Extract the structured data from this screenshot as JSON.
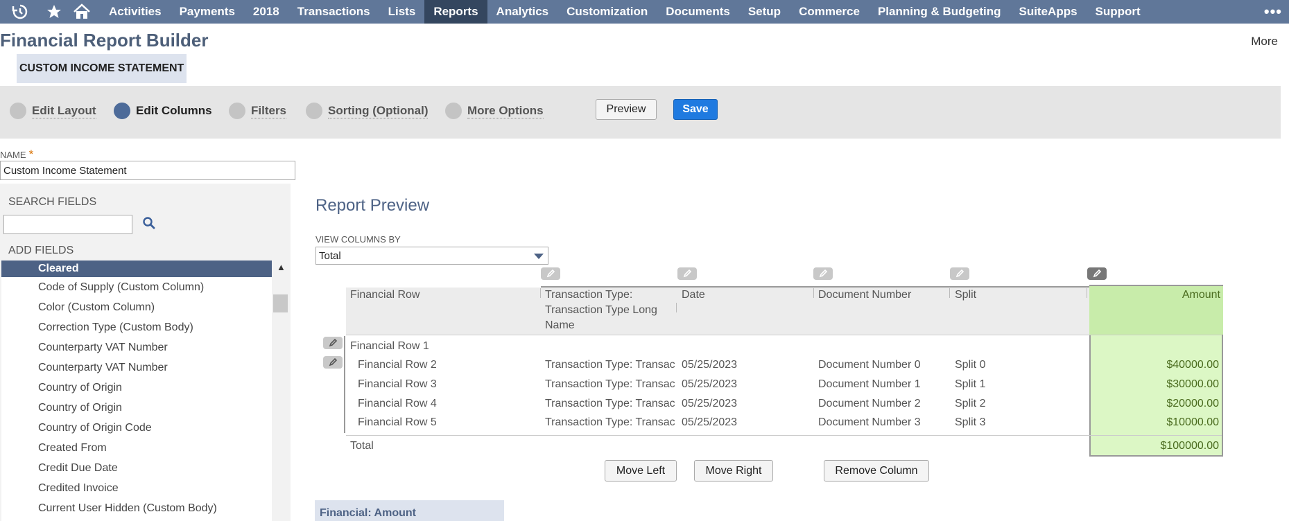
{
  "nav": {
    "items": [
      "Activities",
      "Payments",
      "2018",
      "Transactions",
      "Lists",
      "Reports",
      "Analytics",
      "Customization",
      "Documents",
      "Setup",
      "Commerce",
      "Planning & Budgeting",
      "SuiteApps",
      "Support"
    ],
    "active": "Reports",
    "more_glyph": "•••"
  },
  "header": {
    "title": "Financial Report Builder",
    "more": "More",
    "report_tag": "CUSTOM INCOME STATEMENT"
  },
  "steps": [
    {
      "label": "Edit Layout",
      "current": false
    },
    {
      "label": "Edit Columns",
      "current": true
    },
    {
      "label": "Filters",
      "current": false
    },
    {
      "label": "Sorting (Optional)",
      "current": false
    },
    {
      "label": "More Options",
      "current": false
    }
  ],
  "actions": {
    "preview": "Preview",
    "save": "Save"
  },
  "name_field": {
    "label": "NAME",
    "required": "*",
    "value": "Custom Income Statement"
  },
  "left_panel": {
    "search_title": "SEARCH FIELDS",
    "search_value": "",
    "add_title": "ADD FIELDS",
    "fields": [
      "Cleared",
      "Code of Supply (Custom Column)",
      "Color (Custom Column)",
      "Correction Type (Custom Body)",
      "Counterparty VAT Number",
      "Counterparty VAT Number",
      "Country of Origin",
      "Country of Origin",
      "Country of Origin Code",
      "Created From",
      "Credit Due Date",
      "Credited Invoice",
      "Current User Hidden (Custom Body)"
    ],
    "selected_index": 0
  },
  "preview": {
    "title": "Report Preview",
    "view_by_label": "VIEW COLUMNS BY",
    "view_by_value": "Total",
    "columns": [
      "Financial Row",
      "Transaction Type: Transaction Type Long Name",
      "Date",
      "Document Number",
      "Split",
      "Amount"
    ],
    "columns_lines": {
      "tt1": "Transaction Type:",
      "tt2": "Transaction Type Long",
      "tt3": "Name"
    },
    "group_row": "Financial Row 1",
    "rows": [
      {
        "row": "Financial Row 2",
        "type": "Transaction Type: Transaction Type Long Name",
        "date": "05/25/2023",
        "doc": "Document Number 0",
        "split": "Split 0",
        "amount": "$40000.00"
      },
      {
        "row": "Financial Row 3",
        "type": "Transaction Type: Transaction Type Long Name",
        "date": "05/25/2023",
        "doc": "Document Number 1",
        "split": "Split 1",
        "amount": "$30000.00"
      },
      {
        "row": "Financial Row 4",
        "type": "Transaction Type: Transaction Type Long Name",
        "date": "05/25/2023",
        "doc": "Document Number 2",
        "split": "Split 2",
        "amount": "$20000.00"
      },
      {
        "row": "Financial Row 5",
        "type": "Transaction Type: Transaction Type Long Name",
        "date": "05/25/2023",
        "doc": "Document Number 3",
        "split": "Split 3",
        "amount": "$10000.00"
      }
    ],
    "total_label": "Total",
    "total_amount": "$100000.00",
    "buttons": {
      "move_left": "Move Left",
      "move_right": "Move Right",
      "remove": "Remove Column"
    },
    "bottom_tab": "Financial: Amount"
  },
  "colors": {
    "nav_bg": "#607799",
    "nav_active": "#34465f",
    "save": "#1f7ae0",
    "amount_col": "#dcf7c5"
  }
}
